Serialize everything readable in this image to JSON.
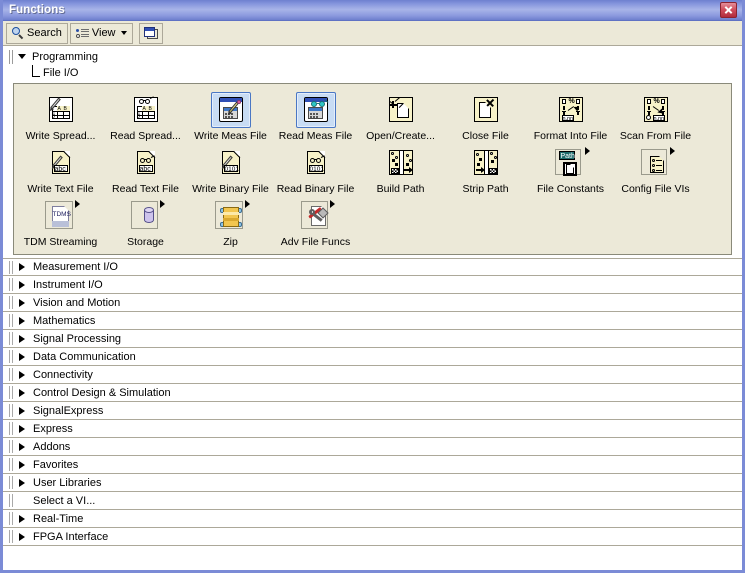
{
  "window": {
    "title": "Functions",
    "close_label": "Close"
  },
  "toolbar": {
    "search_label": "Search",
    "view_label": "View",
    "search_icon": "magnifier-icon",
    "view_icon": "view-list-icon",
    "restore_icon": "restore-window-icon"
  },
  "breadcrumb": {
    "level1": "Programming",
    "level2": "File I/O"
  },
  "palette": {
    "rows": [
      [
        {
          "label": "Write Spread...",
          "icon": "write-spreadsheet-file-icon",
          "selected": false,
          "has_submenu": false
        },
        {
          "label": "Read Spread...",
          "icon": "read-spreadsheet-file-icon",
          "selected": false,
          "has_submenu": false
        },
        {
          "label": "Write Meas File",
          "icon": "write-measurement-file-icon",
          "selected": true,
          "has_submenu": false
        },
        {
          "label": "Read Meas File",
          "icon": "read-measurement-file-icon",
          "selected": true,
          "has_submenu": false
        },
        {
          "label": "Open/Create...",
          "icon": "open-create-replace-file-icon",
          "selected": false,
          "has_submenu": false
        },
        {
          "label": "Close File",
          "icon": "close-file-icon",
          "selected": false,
          "has_submenu": false
        },
        {
          "label": "Format Into File",
          "icon": "format-into-file-icon",
          "selected": false,
          "has_submenu": false
        },
        {
          "label": "Scan From File",
          "icon": "scan-from-file-icon",
          "selected": false,
          "has_submenu": false
        }
      ],
      [
        {
          "label": "Write Text File",
          "icon": "write-text-file-icon",
          "selected": false,
          "has_submenu": false
        },
        {
          "label": "Read Text File",
          "icon": "read-text-file-icon",
          "selected": false,
          "has_submenu": false
        },
        {
          "label": "Write Binary File",
          "icon": "write-binary-file-icon",
          "selected": false,
          "has_submenu": false
        },
        {
          "label": "Read Binary File",
          "icon": "read-binary-file-icon",
          "selected": false,
          "has_submenu": false
        },
        {
          "label": "Build Path",
          "icon": "build-path-icon",
          "selected": false,
          "has_submenu": false
        },
        {
          "label": "Strip Path",
          "icon": "strip-path-icon",
          "selected": false,
          "has_submenu": false
        },
        {
          "label": "File Constants",
          "icon": "file-constants-icon",
          "selected": false,
          "has_submenu": true
        },
        {
          "label": "Config File VIs",
          "icon": "config-file-vis-icon",
          "selected": false,
          "has_submenu": true
        }
      ],
      [
        {
          "label": "TDM Streaming",
          "icon": "tdm-streaming-icon",
          "selected": false,
          "has_submenu": true
        },
        {
          "label": "Storage",
          "icon": "storage-icon",
          "selected": false,
          "has_submenu": true
        },
        {
          "label": "Zip",
          "icon": "zip-icon",
          "selected": false,
          "has_submenu": true
        },
        {
          "label": "Adv File Funcs",
          "icon": "advanced-file-functions-icon",
          "selected": false,
          "has_submenu": true
        }
      ]
    ],
    "icon_text": {
      "abc": "abc",
      "binary": "0101",
      "tdms": "TDMS",
      "path": "Path",
      "percent": "%",
      "nnn": "n.nn"
    }
  },
  "categories": [
    {
      "label": "Measurement I/O",
      "expandable": true
    },
    {
      "label": "Instrument I/O",
      "expandable": true
    },
    {
      "label": "Vision and Motion",
      "expandable": true
    },
    {
      "label": "Mathematics",
      "expandable": true
    },
    {
      "label": "Signal Processing",
      "expandable": true
    },
    {
      "label": "Data Communication",
      "expandable": true
    },
    {
      "label": "Connectivity",
      "expandable": true
    },
    {
      "label": "Control Design & Simulation",
      "expandable": true
    },
    {
      "label": "SignalExpress",
      "expandable": true
    },
    {
      "label": "Express",
      "expandable": true
    },
    {
      "label": "Addons",
      "expandable": true
    },
    {
      "label": "Favorites",
      "expandable": true
    },
    {
      "label": "User Libraries",
      "expandable": true
    },
    {
      "label": "Select a VI...",
      "expandable": false
    },
    {
      "label": "Real-Time",
      "expandable": true
    },
    {
      "label": "FPGA Interface",
      "expandable": true
    }
  ],
  "colors": {
    "titlebar": "#8494dd",
    "toolbar_bg": "#ece9d8",
    "palette_bg": "#ece9d8",
    "selection": "#c8dcf4",
    "icon_paper": "#f7f2c8",
    "border": "#aca899"
  }
}
